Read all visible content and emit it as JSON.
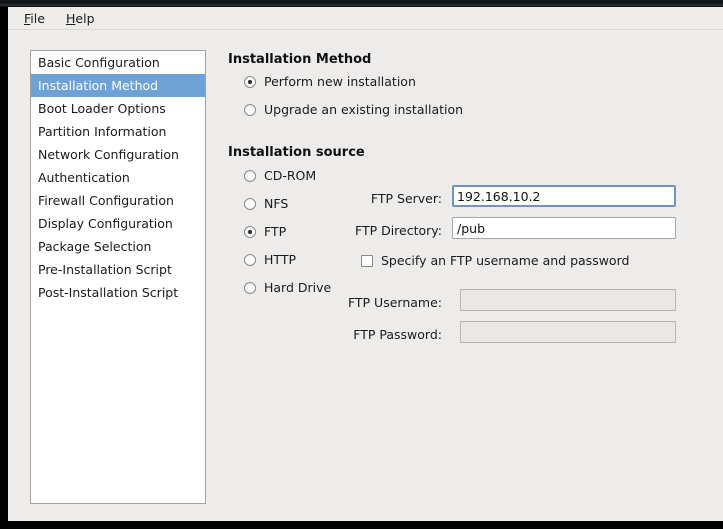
{
  "menubar": {
    "items": [
      {
        "label": "File",
        "mnemonic": "F",
        "rest": "ile"
      },
      {
        "label": "Help",
        "mnemonic": "H",
        "rest": "elp"
      }
    ]
  },
  "sidebar": {
    "items": [
      {
        "label": "Basic Configuration",
        "selected": false
      },
      {
        "label": "Installation Method",
        "selected": true
      },
      {
        "label": "Boot Loader Options",
        "selected": false
      },
      {
        "label": "Partition Information",
        "selected": false
      },
      {
        "label": "Network Configuration",
        "selected": false
      },
      {
        "label": "Authentication",
        "selected": false
      },
      {
        "label": "Firewall Configuration",
        "selected": false
      },
      {
        "label": "Display Configuration",
        "selected": false
      },
      {
        "label": "Package Selection",
        "selected": false
      },
      {
        "label": "Pre-Installation Script",
        "selected": false
      },
      {
        "label": "Post-Installation Script",
        "selected": false
      }
    ],
    "selected_label": "Installation Method",
    "selection_color": "#6ea2d4"
  },
  "main": {
    "installation_method": {
      "title": "Installation Method",
      "options": [
        {
          "label": "Perform new installation",
          "selected": true
        },
        {
          "label": "Upgrade an existing installation",
          "selected": false
        }
      ]
    },
    "installation_source": {
      "title": "Installation source",
      "options": [
        {
          "label": "CD-ROM",
          "selected": false
        },
        {
          "label": "NFS",
          "selected": false
        },
        {
          "label": "FTP",
          "selected": true
        },
        {
          "label": "HTTP",
          "selected": false
        },
        {
          "label": "Hard Drive",
          "selected": false
        }
      ],
      "fields": {
        "server_label": "FTP Server:",
        "server_value": "192.168.10.2",
        "directory_label": "FTP Directory:",
        "directory_value": "/pub",
        "specify_credentials_label": "Specify an FTP username and password",
        "specify_credentials_checked": false,
        "username_label": "FTP Username:",
        "username_value": "",
        "password_label": "FTP Password:",
        "password_value": ""
      },
      "focus_color": "#7093c4"
    }
  }
}
